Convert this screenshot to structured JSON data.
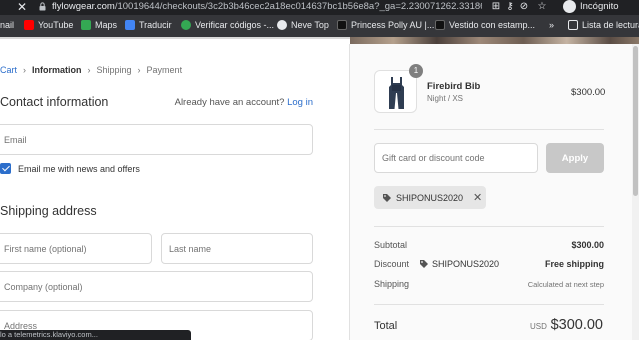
{
  "browser": {
    "url_host": "flylowgear.com",
    "url_path": "/10019644/checkouts/3c2b3b46cec2a18ec014637bc1b56e8a?_ga=2.230071262.33186...",
    "incognito_label": "Incógnito",
    "status_tip": "lo a telemetrics.klaviyo.com...",
    "bookmarks": [
      {
        "label": "nail",
        "color": "#3c4043"
      },
      {
        "label": "YouTube",
        "color": "#ff0000"
      },
      {
        "label": "Maps",
        "color": "#34a853"
      },
      {
        "label": "Traducir",
        "color": "#4285f4"
      },
      {
        "label": "Verificar códigos -...",
        "color": "#34a853"
      },
      {
        "label": "Neve Top",
        "color": "#e8eaed"
      },
      {
        "label": "Princess Polly AU |...",
        "color": "#111111"
      },
      {
        "label": "Vestido con estamp...",
        "color": "#111111"
      },
      {
        "label": "»",
        "color": ""
      },
      {
        "label": "Lista de lectura",
        "color": "#e8eaed"
      }
    ]
  },
  "breadcrumb": {
    "items": [
      "Cart",
      "Information",
      "Shipping",
      "Payment"
    ]
  },
  "contact": {
    "title": "Contact information",
    "have_account": "Already have an account?",
    "login_link": "Log in",
    "email_placeholder": "Email",
    "newsletter_label": "Email me with news and offers"
  },
  "shipping": {
    "title": "Shipping address",
    "first_name_placeholder": "First name (optional)",
    "last_name_placeholder": "Last name",
    "company_placeholder": "Company (optional)",
    "address_placeholder": "Address"
  },
  "order": {
    "product": {
      "quantity": "1",
      "name": "Firebird Bib",
      "variant": "Night / XS",
      "price": "$300.00"
    },
    "gift_placeholder": "Gift card or discount code",
    "apply_label": "Apply",
    "applied_code": "SHIPONUS2020",
    "subtotal_label": "Subtotal",
    "subtotal_value": "$300.00",
    "discount_label": "Discount",
    "discount_code": "SHIPONUS2020",
    "discount_value": "Free shipping",
    "shipping_label": "Shipping",
    "shipping_value": "Calculated at next step",
    "total_label": "Total",
    "total_currency": "USD",
    "total_value": "$300.00"
  },
  "colors": {
    "accent": "#2c6ecb",
    "apply_disabled": "#c8c8c8",
    "summary_bg": "#fafafa"
  }
}
